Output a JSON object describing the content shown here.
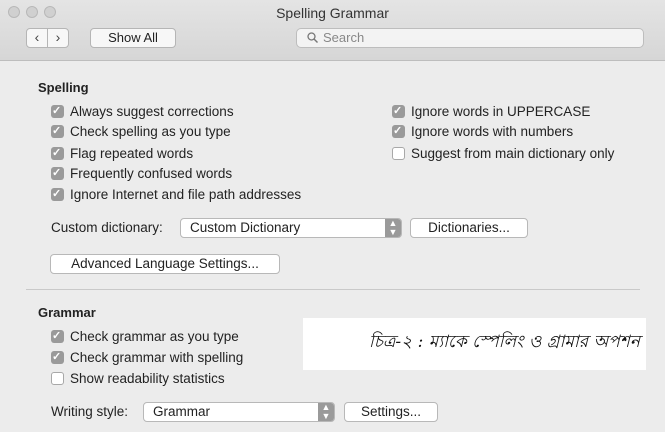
{
  "window": {
    "title": "Spelling  Grammar"
  },
  "toolbar": {
    "back_glyph": "‹",
    "forward_glyph": "›",
    "show_all_label": "Show All",
    "search_placeholder": "Search",
    "search_icon": "magnifier"
  },
  "spelling": {
    "title": "Spelling",
    "left_options": [
      {
        "label": "Always suggest corrections",
        "checked": true
      },
      {
        "label": "Check spelling as you type",
        "checked": true
      },
      {
        "label": "Flag repeated words",
        "checked": true
      },
      {
        "label": "Frequently confused words",
        "checked": true
      },
      {
        "label": "Ignore Internet and file path addresses",
        "checked": true
      }
    ],
    "right_options": [
      {
        "label": "Ignore words in UPPERCASE",
        "checked": true
      },
      {
        "label": "Ignore words with numbers",
        "checked": true
      },
      {
        "label": "Suggest from main dictionary only",
        "checked": false
      }
    ],
    "custom_dictionary_label": "Custom dictionary:",
    "custom_dictionary_value": "Custom Dictionary",
    "dictionaries_button": "Dictionaries...",
    "advanced_button": "Advanced Language Settings..."
  },
  "grammar": {
    "title": "Grammar",
    "options": [
      {
        "label": "Check grammar as you type",
        "checked": true
      },
      {
        "label": "Check grammar with spelling",
        "checked": true
      },
      {
        "label": "Show readability statistics",
        "checked": false
      }
    ],
    "writing_style_label": "Writing style:",
    "writing_style_value": "Grammar",
    "settings_button": "Settings..."
  },
  "caption": "চিত্র-২ : ম্যাকে স্পেলিং ও গ্রামার অপশন",
  "colors": {
    "checkbox_on": "#9a9a9a",
    "window_bg": "#ececec"
  }
}
